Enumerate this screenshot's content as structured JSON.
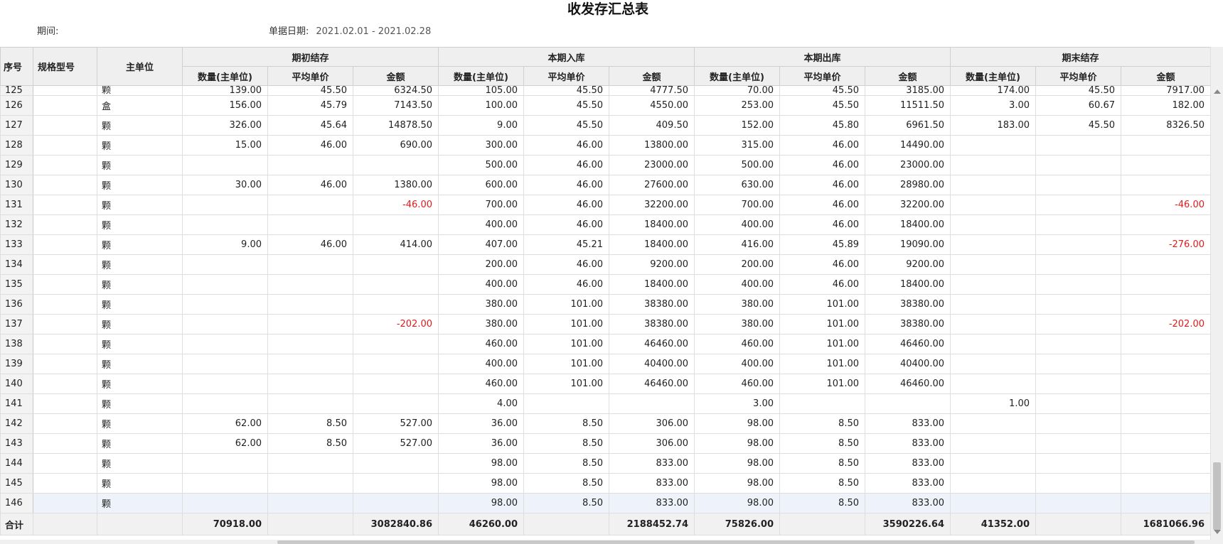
{
  "report": {
    "title": "收发存汇总表",
    "period_label": "期间:",
    "date_label": "单据日期:",
    "date_range": "2021.02.01 - 2021.02.28"
  },
  "columns": {
    "seq": "序号",
    "spec": "规格型号",
    "unit": "主单位",
    "groups": [
      "期初结存",
      "本期入库",
      "本期出库",
      "期末结存"
    ],
    "sub": [
      "数量(主单位)",
      "平均单价",
      "金额"
    ]
  },
  "rows": [
    [
      "125",
      "",
      "颗",
      "139.00",
      "45.50",
      "6324.50",
      "105.00",
      "45.50",
      "4777.50",
      "70.00",
      "45.50",
      "3185.00",
      "174.00",
      "45.50",
      "7917.00"
    ],
    [
      "126",
      "",
      "盒",
      "156.00",
      "45.79",
      "7143.50",
      "100.00",
      "45.50",
      "4550.00",
      "253.00",
      "45.50",
      "11511.50",
      "3.00",
      "60.67",
      "182.00"
    ],
    [
      "127",
      "",
      "颗",
      "326.00",
      "45.64",
      "14878.50",
      "9.00",
      "45.50",
      "409.50",
      "152.00",
      "45.80",
      "6961.50",
      "183.00",
      "45.50",
      "8326.50"
    ],
    [
      "128",
      "",
      "颗",
      "15.00",
      "46.00",
      "690.00",
      "300.00",
      "46.00",
      "13800.00",
      "315.00",
      "46.00",
      "14490.00",
      "",
      "",
      ""
    ],
    [
      "129",
      "",
      "颗",
      "",
      "",
      "",
      "500.00",
      "46.00",
      "23000.00",
      "500.00",
      "46.00",
      "23000.00",
      "",
      "",
      ""
    ],
    [
      "130",
      "",
      "颗",
      "30.00",
      "46.00",
      "1380.00",
      "600.00",
      "46.00",
      "27600.00",
      "630.00",
      "46.00",
      "28980.00",
      "",
      "",
      ""
    ],
    [
      "131",
      "",
      "颗",
      "",
      "",
      "-46.00",
      "700.00",
      "46.00",
      "32200.00",
      "700.00",
      "46.00",
      "32200.00",
      "",
      "",
      "-46.00"
    ],
    [
      "132",
      "",
      "颗",
      "",
      "",
      "",
      "400.00",
      "46.00",
      "18400.00",
      "400.00",
      "46.00",
      "18400.00",
      "",
      "",
      ""
    ],
    [
      "133",
      "",
      "颗",
      "9.00",
      "46.00",
      "414.00",
      "407.00",
      "45.21",
      "18400.00",
      "416.00",
      "45.89",
      "19090.00",
      "",
      "",
      "-276.00"
    ],
    [
      "134",
      "",
      "颗",
      "",
      "",
      "",
      "200.00",
      "46.00",
      "9200.00",
      "200.00",
      "46.00",
      "9200.00",
      "",
      "",
      ""
    ],
    [
      "135",
      "",
      "颗",
      "",
      "",
      "",
      "400.00",
      "46.00",
      "18400.00",
      "400.00",
      "46.00",
      "18400.00",
      "",
      "",
      ""
    ],
    [
      "136",
      "",
      "颗",
      "",
      "",
      "",
      "380.00",
      "101.00",
      "38380.00",
      "380.00",
      "101.00",
      "38380.00",
      "",
      "",
      ""
    ],
    [
      "137",
      "",
      "颗",
      "",
      "",
      "-202.00",
      "380.00",
      "101.00",
      "38380.00",
      "380.00",
      "101.00",
      "38380.00",
      "",
      "",
      "-202.00"
    ],
    [
      "138",
      "",
      "颗",
      "",
      "",
      "",
      "460.00",
      "101.00",
      "46460.00",
      "460.00",
      "101.00",
      "46460.00",
      "",
      "",
      ""
    ],
    [
      "139",
      "",
      "颗",
      "",
      "",
      "",
      "400.00",
      "101.00",
      "40400.00",
      "400.00",
      "101.00",
      "40400.00",
      "",
      "",
      ""
    ],
    [
      "140",
      "",
      "颗",
      "",
      "",
      "",
      "460.00",
      "101.00",
      "46460.00",
      "460.00",
      "101.00",
      "46460.00",
      "",
      "",
      ""
    ],
    [
      "141",
      "",
      "颗",
      "",
      "",
      "",
      "4.00",
      "",
      "",
      "3.00",
      "",
      "",
      "1.00",
      "",
      ""
    ],
    [
      "142",
      "",
      "颗",
      "62.00",
      "8.50",
      "527.00",
      "36.00",
      "8.50",
      "306.00",
      "98.00",
      "8.50",
      "833.00",
      "",
      "",
      ""
    ],
    [
      "143",
      "",
      "颗",
      "62.00",
      "8.50",
      "527.00",
      "36.00",
      "8.50",
      "306.00",
      "98.00",
      "8.50",
      "833.00",
      "",
      "",
      ""
    ],
    [
      "144",
      "",
      "颗",
      "",
      "",
      "",
      "98.00",
      "8.50",
      "833.00",
      "98.00",
      "8.50",
      "833.00",
      "",
      "",
      ""
    ],
    [
      "145",
      "",
      "颗",
      "",
      "",
      "",
      "98.00",
      "8.50",
      "833.00",
      "98.00",
      "8.50",
      "833.00",
      "",
      "",
      ""
    ],
    [
      "146",
      "",
      "颗",
      "",
      "",
      "",
      "98.00",
      "8.50",
      "833.00",
      "98.00",
      "8.50",
      "833.00",
      "",
      "",
      ""
    ]
  ],
  "total": [
    "合计",
    "",
    "",
    "70918.00",
    "",
    "3082840.86",
    "46260.00",
    "",
    "2188452.74",
    "75826.00",
    "",
    "3590226.64",
    "41352.00",
    "",
    "1681066.96"
  ],
  "colors": {
    "negative": "#e01b1b",
    "header_bg": "#efefef",
    "selected_row": "#eef3fb"
  }
}
